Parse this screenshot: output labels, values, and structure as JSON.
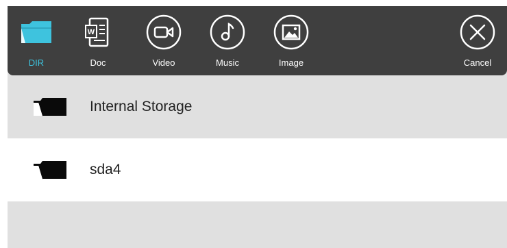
{
  "toolbar": {
    "tools": [
      {
        "label": "DIR",
        "icon": "folder-icon",
        "active": true
      },
      {
        "label": "Doc",
        "icon": "word-document-icon",
        "active": false
      },
      {
        "label": "Video",
        "icon": "video-camera-icon",
        "active": false
      },
      {
        "label": "Music",
        "icon": "music-note-icon",
        "active": false
      },
      {
        "label": "Image",
        "icon": "image-icon",
        "active": false
      }
    ],
    "cancel_label": "Cancel",
    "accent_color": "#3ec3de",
    "bar_color": "#3f3f3f"
  },
  "storage_list": [
    {
      "name": "Internal Storage",
      "icon": "folder-icon",
      "selected": true
    },
    {
      "name": "sda4",
      "icon": "folder-icon",
      "selected": false
    }
  ]
}
